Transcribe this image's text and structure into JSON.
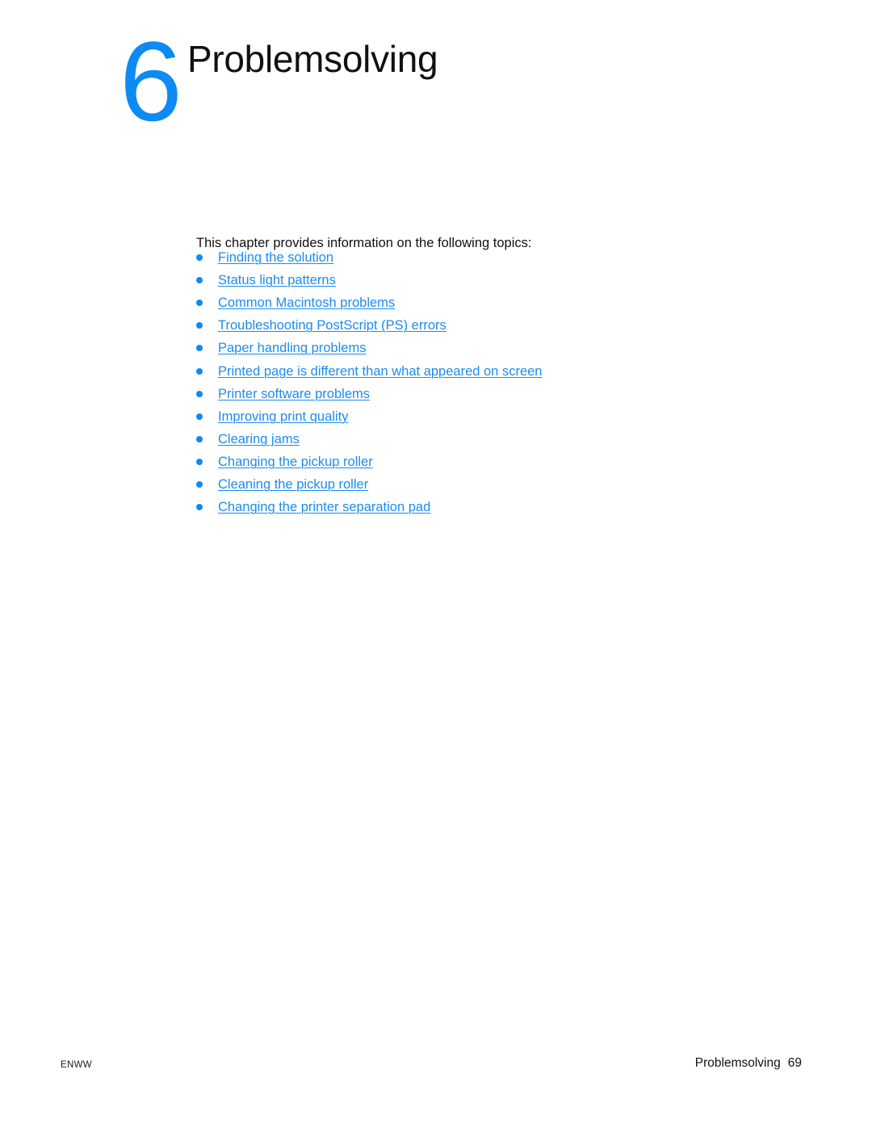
{
  "colors": {
    "accent_blue": "#0d8bf2",
    "link_blue": "#1b8cf0",
    "text_black": "#111111",
    "page_background": "#ffffff"
  },
  "chapter": {
    "number": "6",
    "title": "Problemsolving"
  },
  "intro": {
    "text": "This chapter provides information on the following topics:"
  },
  "topics": [
    {
      "label": "Finding the solution"
    },
    {
      "label": "Status light patterns"
    },
    {
      "label": "Common Macintosh problems"
    },
    {
      "label": "Troubleshooting PostScript (PS) errors"
    },
    {
      "label": "Paper handling problems"
    },
    {
      "label": "Printed page is different than what appeared on screen"
    },
    {
      "label": "Printer software problems"
    },
    {
      "label": "Improving print quality"
    },
    {
      "label": "Clearing jams"
    },
    {
      "label": "Changing the pickup roller"
    },
    {
      "label": "Cleaning the pickup roller"
    },
    {
      "label": "Changing the printer separation pad"
    }
  ],
  "footer": {
    "left": "ENWW",
    "chapter_name": "Problemsolving",
    "page_number": "69"
  }
}
